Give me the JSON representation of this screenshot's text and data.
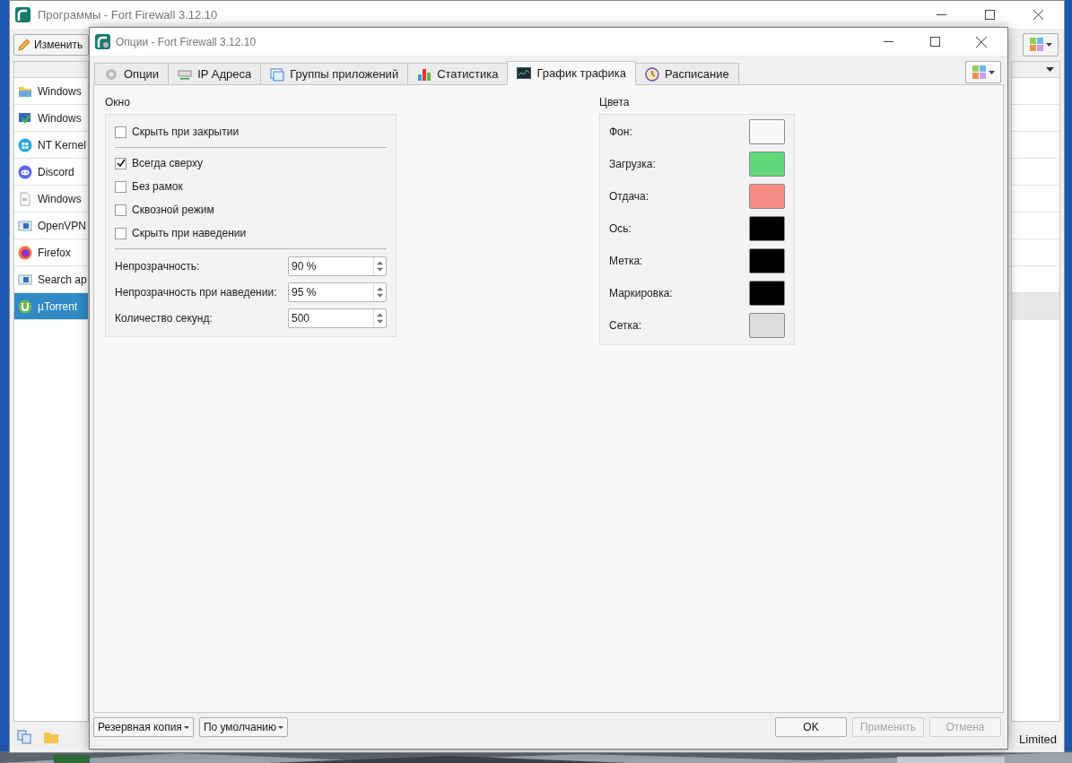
{
  "main_window": {
    "title": "Программы - Fort Firewall 3.12.10",
    "edit_button": "Изменить",
    "apps": [
      {
        "name": "Windows",
        "selected": false
      },
      {
        "name": "Windows",
        "selected": false
      },
      {
        "name": "NT Kernel",
        "selected": false
      },
      {
        "name": "Discord",
        "selected": false
      },
      {
        "name": "Windows",
        "selected": false
      },
      {
        "name": "OpenVPN",
        "selected": false
      },
      {
        "name": "Firefox",
        "selected": false
      },
      {
        "name": "Search ap",
        "selected": false
      },
      {
        "name": "µTorrent",
        "selected": true
      }
    ],
    "status_text": "Limited"
  },
  "dialog": {
    "title": "Опции - Fort Firewall 3.12.10",
    "tabs": [
      {
        "label": "Опции",
        "selected": false
      },
      {
        "label": "IP Адреса",
        "selected": false
      },
      {
        "label": "Группы приложений",
        "selected": false
      },
      {
        "label": "Статистика",
        "selected": false
      },
      {
        "label": "График трафика",
        "selected": true
      },
      {
        "label": "Расписание",
        "selected": false
      }
    ],
    "window_group": {
      "title": "Окно",
      "checkbox_sections": [
        [
          {
            "label": "Скрыть при закрытии",
            "checked": false
          }
        ],
        [
          {
            "label": "Всегда сверху",
            "checked": true
          },
          {
            "label": "Без рамок",
            "checked": false
          },
          {
            "label": "Сквозной режим",
            "checked": false
          },
          {
            "label": "Скрыть при наведении",
            "checked": false
          }
        ]
      ],
      "spinboxes": [
        {
          "label": "Непрозрачность:",
          "value": "90 %"
        },
        {
          "label": "Непрозрачность при наведении:",
          "value": "95 %"
        },
        {
          "label": "Количество секунд:",
          "value": "500"
        }
      ]
    },
    "colors_group": {
      "title": "Цвета",
      "colors": [
        {
          "label": "Фон:",
          "color": "#f8f8f8"
        },
        {
          "label": "Загрузка:",
          "color": "#5fd77a"
        },
        {
          "label": "Отдача:",
          "color": "#f58c84"
        },
        {
          "label": "Ось:",
          "color": "#000000"
        },
        {
          "label": "Метка:",
          "color": "#000000"
        },
        {
          "label": "Маркировка:",
          "color": "#000000"
        },
        {
          "label": "Сетка:",
          "color": "#dcdcdc"
        }
      ]
    },
    "bottom_left": [
      {
        "label": "Резервная копия"
      },
      {
        "label": "По умолчанию"
      }
    ],
    "buttons": [
      {
        "label": "OK",
        "disabled": false
      },
      {
        "label": "Применить",
        "disabled": true
      },
      {
        "label": "Отмена",
        "disabled": true
      }
    ]
  }
}
